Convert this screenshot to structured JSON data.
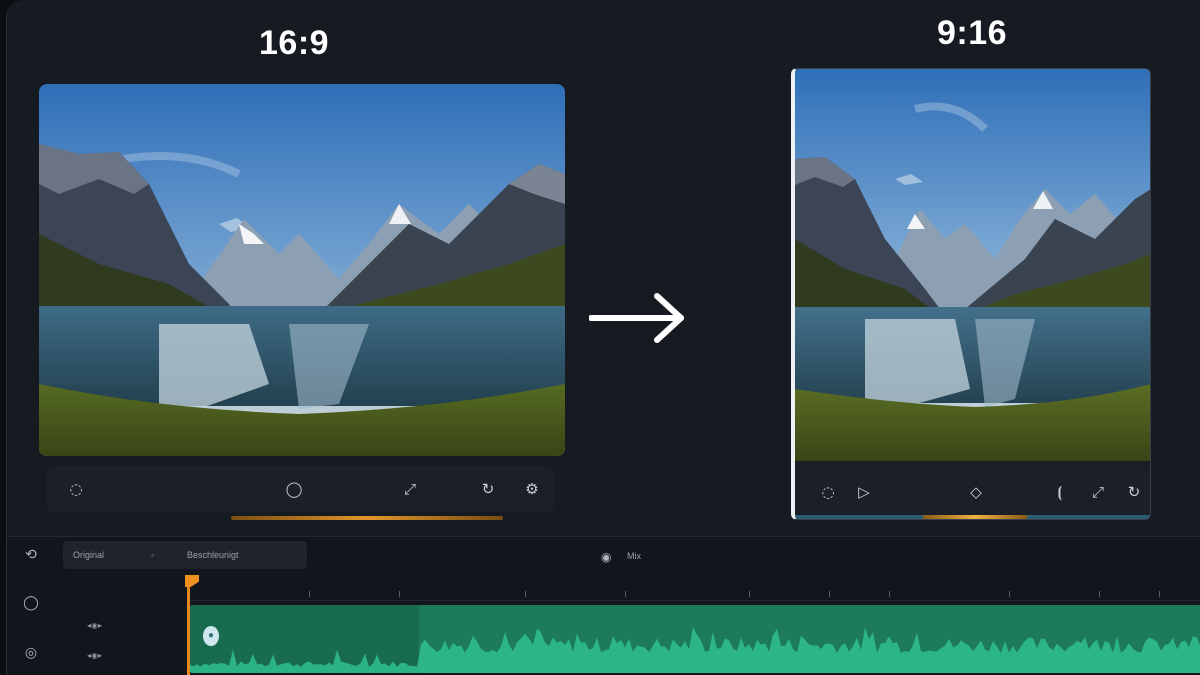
{
  "labels": {
    "source_ratio": "16:9",
    "target_ratio": "9:16"
  },
  "icons": {
    "arrow": "right-arrow-icon",
    "play": "play-icon",
    "mute": "speaker-icon",
    "fullscreen": "fullscreen-icon",
    "settings": "gear-icon"
  },
  "colors": {
    "accent_orange": "#e8871f",
    "audio_track": "#1d7a5b",
    "background": "#161a21"
  },
  "timeline": {
    "tab_1": "Original",
    "tab_2": "Beschleunigt",
    "tab_center": "Mix"
  },
  "progress": {
    "left_fraction": 1.0,
    "right_fraction": 0.3
  }
}
